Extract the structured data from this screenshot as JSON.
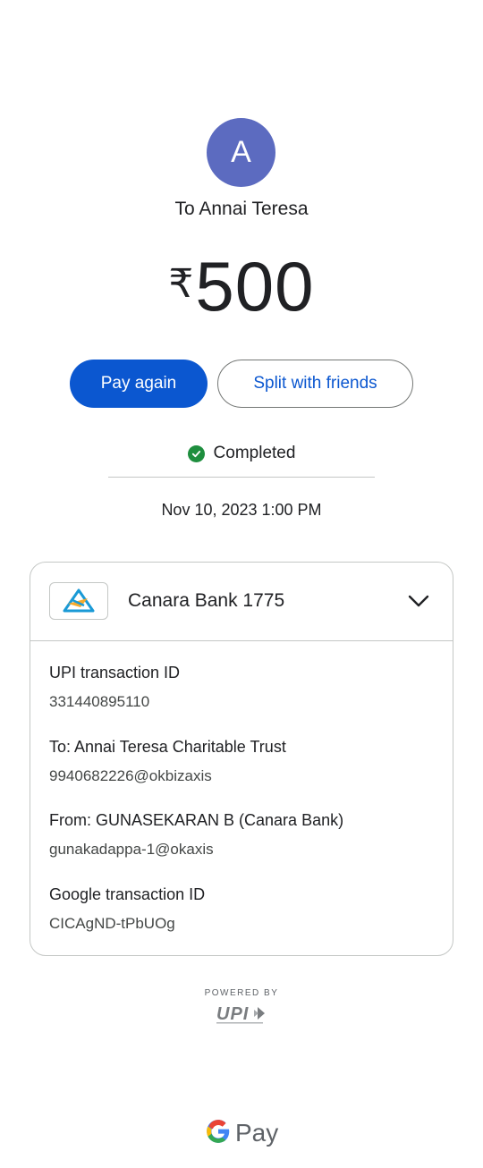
{
  "recipient": {
    "initial": "A",
    "avatar_color": "#5c6bc0",
    "title": "To Annai Teresa"
  },
  "amount": {
    "currency": "₹",
    "value": "500"
  },
  "actions": {
    "pay_again": "Pay again",
    "split": "Split with friends"
  },
  "status": {
    "text": "Completed",
    "color": "#1e8e3e",
    "icon": "check-circle-icon"
  },
  "datetime": "Nov 10, 2023 1:00 PM",
  "card": {
    "bank_name": "Canara Bank 1775",
    "bank_logo": "canara-bank-logo",
    "details": [
      {
        "label": "UPI transaction ID",
        "value": "331440895110"
      },
      {
        "label": "To: Annai Teresa Charitable Trust",
        "value": "9940682226@okbizaxis"
      },
      {
        "label": "From: GUNASEKARAN B (Canara Bank)",
        "value": "gunakadappa-1@okaxis"
      },
      {
        "label": "Google transaction ID",
        "value": "CICAgND-tPbUOg"
      }
    ]
  },
  "footer": {
    "powered_by": "POWERED BY",
    "upi_logo": "upi-logo",
    "brand": "Pay"
  },
  "colors": {
    "primary": "#0b57d0",
    "text": "#202124",
    "secondary_text": "#444746",
    "border": "#c4c7c5"
  }
}
